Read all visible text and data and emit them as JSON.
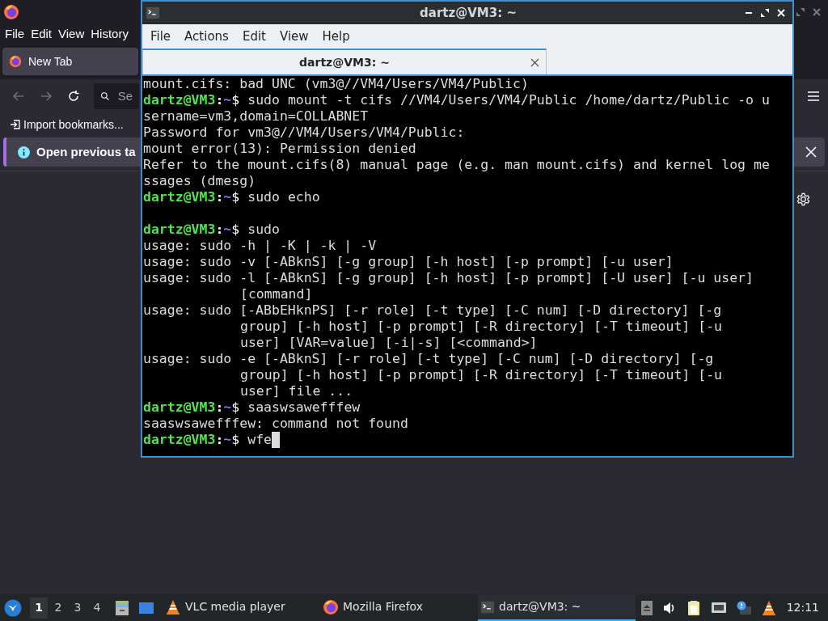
{
  "browser": {
    "menu": [
      "File",
      "Edit",
      "View",
      "History"
    ],
    "tabs": [
      {
        "label": "New Tab",
        "selected": true
      }
    ],
    "search": {
      "placeholder": "Se"
    },
    "bookmarks": [
      "Import bookmarks..."
    ],
    "notification": {
      "text": "Open previous ta"
    }
  },
  "terminal": {
    "title": "dartz@VM3: ~",
    "menu": [
      "File",
      "Actions",
      "Edit",
      "View",
      "Help"
    ],
    "tabs": [
      {
        "label": "dartz@VM3: ~",
        "selected": true
      }
    ],
    "lines": [
      {
        "kind": "output",
        "text": "mount.cifs: bad UNC (vm3@//VM4/Users/VM4/Public)"
      },
      {
        "kind": "prompt",
        "prompt": [
          "dartz@VM3",
          ":",
          "~",
          "$"
        ],
        "command": "sudo mount -t cifs //VM4/Users/VM4/Public /home/dartz/Public -o u",
        "cursor": false
      },
      {
        "kind": "output",
        "text": "sername=vm3,domain=COLLABNET"
      },
      {
        "kind": "output",
        "text": "Password for vm3@//VM4/Users/VM4/Public:"
      },
      {
        "kind": "output",
        "text": "mount error(13): Permission denied"
      },
      {
        "kind": "output",
        "text": "Refer to the mount.cifs(8) manual page (e.g. man mount.cifs) and kernel log me"
      },
      {
        "kind": "output",
        "text": "ssages (dmesg)"
      },
      {
        "kind": "prompt",
        "prompt": [
          "dartz@VM3",
          ":",
          "~",
          "$"
        ],
        "command": "sudo echo",
        "cursor": false
      },
      {
        "kind": "blank"
      },
      {
        "kind": "prompt",
        "prompt": [
          "dartz@VM3",
          ":",
          "~",
          "$"
        ],
        "command": "sudo",
        "cursor": false
      },
      {
        "kind": "output",
        "text": "usage: sudo -h | -K | -k | -V"
      },
      {
        "kind": "output",
        "text": "usage: sudo -v [-ABknS] [-g group] [-h host] [-p prompt] [-u user]"
      },
      {
        "kind": "output",
        "text": "usage: sudo -l [-ABknS] [-g group] [-h host] [-p prompt] [-U user] [-u user]"
      },
      {
        "kind": "continuation",
        "text": "[command]"
      },
      {
        "kind": "output",
        "text": "usage: sudo [-ABbEHknPS] [-r role] [-t type] [-C num] [-D directory] [-g"
      },
      {
        "kind": "continuation",
        "text": "group] [-h host] [-p prompt] [-R directory] [-T timeout] [-u"
      },
      {
        "kind": "continuation",
        "text": "user] [VAR=value] [-i|-s] [<command>]"
      },
      {
        "kind": "output",
        "text": "usage: sudo -e [-ABknS] [-r role] [-t type] [-C num] [-D directory] [-g"
      },
      {
        "kind": "continuation",
        "text": "group] [-h host] [-p prompt] [-R directory] [-T timeout] [-u"
      },
      {
        "kind": "continuation",
        "text": "user] file ..."
      },
      {
        "kind": "prompt",
        "prompt": [
          "dartz@VM3",
          ":",
          "~",
          "$"
        ],
        "command": "saaswsawefffew",
        "cursor": false
      },
      {
        "kind": "output",
        "text": "saaswsawefffew: command not found"
      },
      {
        "kind": "prompt",
        "prompt": [
          "dartz@VM3",
          ":",
          "~",
          "$"
        ],
        "command": "wfe",
        "cursor": true
      }
    ]
  },
  "taskbar": {
    "workspaces": [
      {
        "label": "1",
        "selected": true
      },
      {
        "label": "2",
        "selected": false
      },
      {
        "label": "3",
        "selected": false
      },
      {
        "label": "4",
        "selected": false
      }
    ],
    "tasks": [
      {
        "kind": "vlc",
        "label": "VLC media player",
        "selected": false
      },
      {
        "kind": "firefox",
        "label": "Mozilla Firefox",
        "selected": false
      },
      {
        "kind": "terminal",
        "label": "dartz@VM3: ~",
        "selected": true
      }
    ],
    "clock": "12:11"
  }
}
